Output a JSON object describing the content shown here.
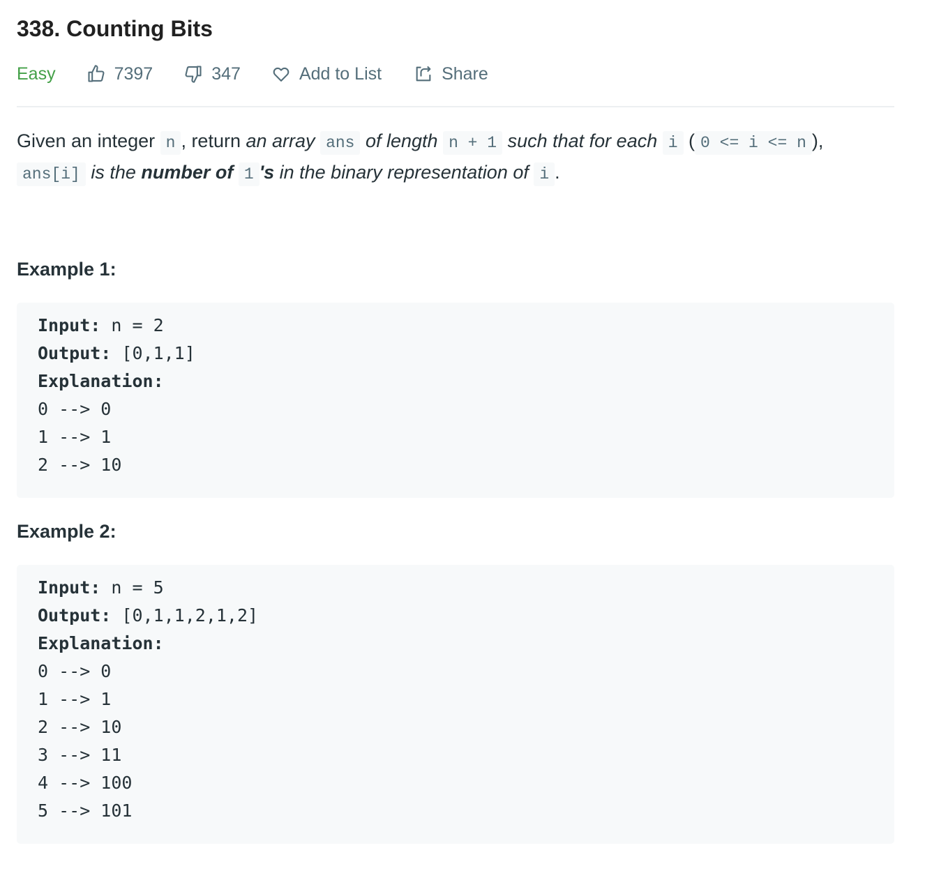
{
  "problem": {
    "title": "338. Counting Bits",
    "difficulty": "Easy",
    "likes": "7397",
    "dislikes": "347",
    "add_to_list": "Add to List",
    "share": "Share"
  },
  "description": {
    "t1": "Given an integer ",
    "c_n": "n",
    "t2": ", return ",
    "e_array": "an array",
    "c_ans": "ans",
    "e_oflength": " of length ",
    "c_n1": "n + 1",
    "e_such": " such that for each ",
    "c_i": "i",
    "t3": " (",
    "c_range": "0 <= i <= n",
    "t4": "),",
    "c_ansi": "ans[i]",
    "e_isthe": " is the ",
    "b_number": "number of ",
    "c_one": "1",
    "b_s": "'s",
    "e_inbinary": " in the binary representation of ",
    "c_i2": "i",
    "t5": "."
  },
  "examples": [
    {
      "title": "Example 1:",
      "input_label": "Input:",
      "input_value": " n = 2",
      "output_label": "Output:",
      "output_value": " [0,1,1]",
      "explanation_label": "Explanation:",
      "lines": [
        "0 --> 0",
        "1 --> 1",
        "2 --> 10"
      ]
    },
    {
      "title": "Example 2:",
      "input_label": "Input:",
      "input_value": " n = 5",
      "output_label": "Output:",
      "output_value": " [0,1,1,2,1,2]",
      "explanation_label": "Explanation:",
      "lines": [
        "0 --> 0",
        "1 --> 1",
        "2 --> 10",
        "3 --> 11",
        "4 --> 100",
        "5 --> 101"
      ]
    }
  ],
  "colors": {
    "easy": "#43a047",
    "meta_text": "#546e7a",
    "code_bg": "#f7f9fa"
  },
  "icons": [
    "thumbs-up-icon",
    "thumbs-down-icon",
    "heart-icon",
    "share-icon"
  ]
}
